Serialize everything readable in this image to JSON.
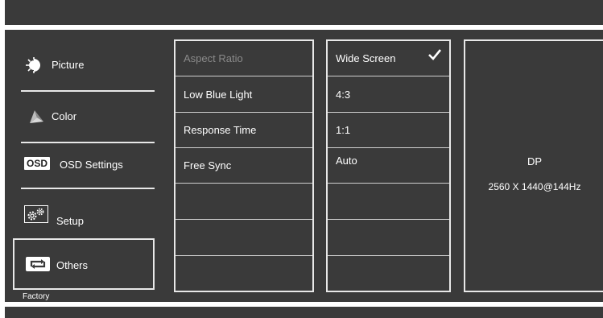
{
  "menu": {
    "items": [
      {
        "label": "Picture",
        "icon": "picture-brightness-icon"
      },
      {
        "label": "Color",
        "icon": "color-palette-icon"
      },
      {
        "label": "OSD Settings",
        "icon": "osd-icon",
        "icon_text": "OSD"
      },
      {
        "label": "Setup",
        "icon": "gears-icon"
      },
      {
        "label": "Others",
        "icon": "loop-arrows-icon"
      }
    ],
    "selected": "Others",
    "footer": "Factory"
  },
  "settings": {
    "items": [
      "Aspect Ratio",
      "Low Blue Light",
      "Response Time",
      "Free Sync",
      "",
      "",
      ""
    ]
  },
  "options": {
    "items": [
      "Wide Screen",
      "4:3",
      "1:1",
      "Auto",
      "",
      "",
      ""
    ],
    "selected": "Wide Screen"
  },
  "info": {
    "input": "DP",
    "resolution": "2560 X 1440@144Hz"
  },
  "colors": {
    "background": "#3a3a3a",
    "border": "#e8e8e8",
    "dim_text": "#8a8a8a"
  }
}
